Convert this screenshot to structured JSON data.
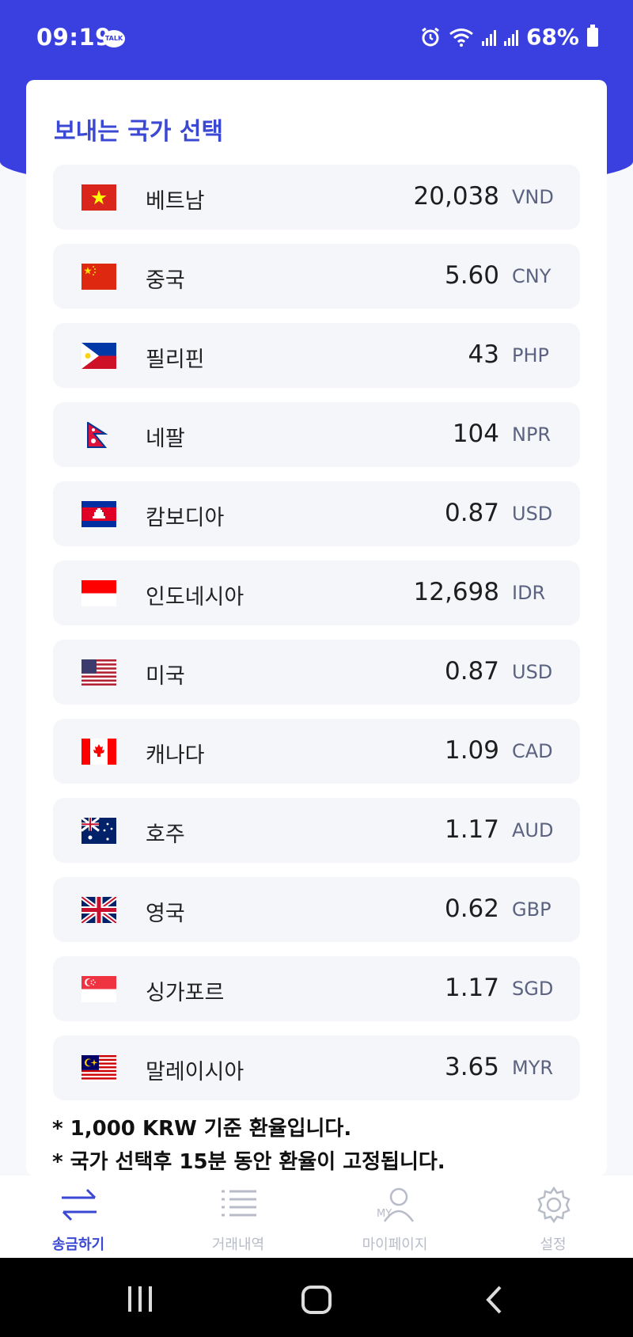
{
  "status_bar": {
    "time": "09:19",
    "talk": "TALK",
    "battery": "68%"
  },
  "title": "보내는 국가 선택",
  "countries": [
    {
      "name": "베트남",
      "rate": "20,038",
      "currency": "VND",
      "flag": "vietnam-flag-icon"
    },
    {
      "name": "중국",
      "rate": "5.60",
      "currency": "CNY",
      "flag": "china-flag-icon"
    },
    {
      "name": "필리핀",
      "rate": "43",
      "currency": "PHP",
      "flag": "philippines-flag-icon"
    },
    {
      "name": "네팔",
      "rate": "104",
      "currency": "NPR",
      "flag": "nepal-flag-icon"
    },
    {
      "name": "캄보디아",
      "rate": "0.87",
      "currency": "USD",
      "flag": "cambodia-flag-icon"
    },
    {
      "name": "인도네시아",
      "rate": "12,698",
      "currency": "IDR",
      "flag": "indonesia-flag-icon"
    },
    {
      "name": "미국",
      "rate": "0.87",
      "currency": "USD",
      "flag": "usa-flag-icon"
    },
    {
      "name": "캐나다",
      "rate": "1.09",
      "currency": "CAD",
      "flag": "canada-flag-icon"
    },
    {
      "name": "호주",
      "rate": "1.17",
      "currency": "AUD",
      "flag": "australia-flag-icon"
    },
    {
      "name": "영국",
      "rate": "0.62",
      "currency": "GBP",
      "flag": "uk-flag-icon"
    },
    {
      "name": "싱가포르",
      "rate": "1.17",
      "currency": "SGD",
      "flag": "singapore-flag-icon"
    },
    {
      "name": "말레이시아",
      "rate": "3.65",
      "currency": "MYR",
      "flag": "malaysia-flag-icon"
    }
  ],
  "notes": [
    "* 1,000 KRW 기준 환율입니다.",
    "* 국가 선택후 15분 동안 환율이 고정됩니다."
  ],
  "tabs": [
    {
      "label": "송금하기",
      "icon": "transfer-icon",
      "active": true
    },
    {
      "label": "거래내역",
      "icon": "history-list-icon",
      "active": false
    },
    {
      "label": "마이페이지",
      "icon": "mypage-icon",
      "active": false,
      "icon_text": "MY"
    },
    {
      "label": "설정",
      "icon": "gear-icon",
      "active": false
    }
  ],
  "colors": {
    "primary": "#3a3fe0",
    "accent_text": "#3b48d3",
    "row_bg": "#f4f6fa",
    "inactive": "#b7bcc8"
  }
}
